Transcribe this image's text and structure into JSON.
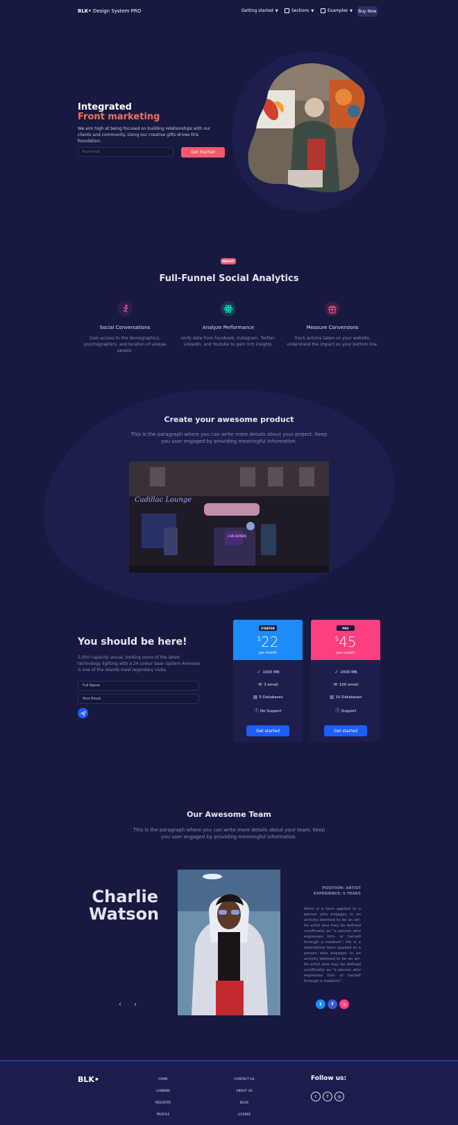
{
  "nav": {
    "brand_bold": "BLK•",
    "brand_rest": " Design System PRO",
    "items": [
      {
        "label": "Getting started",
        "icon": "none"
      },
      {
        "label": "Sections",
        "icon": "sections-icon"
      },
      {
        "label": "Examples",
        "icon": "examples-icon"
      }
    ],
    "buy_label": "Buy Now"
  },
  "hero": {
    "title_line1": "Integrated",
    "title_line2": "Front marketing",
    "text": "We aim high at being focused on building relationships with our clients and community. Using our creative gifts drives this foundation.",
    "email_placeholder": "Your email",
    "cta_label": "Get Started"
  },
  "analytics": {
    "badge": "INSIGHT",
    "title": "Full-Funnel Social Analytics",
    "features": [
      {
        "icon": "running-person-icon",
        "title": "Social Conversations",
        "text": "Gain access to the demographics, psychographics, and location of unique people.",
        "color": "#e14eca"
      },
      {
        "icon": "atom-icon",
        "title": "Analyze Performance",
        "text": "Unify data from Facebook, Instagram, Twitter, LinkedIn, and Youtube to gain rich insights.",
        "color": "#00f2c3"
      },
      {
        "icon": "gift-icon",
        "title": "Measure Conversions",
        "text": "Track actions taken on your website, understand the impact on your bottom line.",
        "color": "#fd5d93"
      }
    ]
  },
  "product": {
    "title": "Create your awesome product",
    "text": "This is the paragraph where you can write more details about your project. Keep you user engaged by providing meaningful information.",
    "sign_text": "Cadillac Lounge",
    "sign_live": "LIVE BANDS"
  },
  "pricing": {
    "title": "You should be here!",
    "text": "5,000 capacity venue, holding some of the latest technology lighting with a 24 colour laser system Amnesia is one of the islands most legendary clubs.",
    "name_placeholder": "Full Name",
    "email_placeholder": "Your Email",
    "cards": [
      {
        "badge": "STARTER",
        "currency": "$",
        "price": "22",
        "period": "per month",
        "color": "#1d8cf8",
        "features": [
          {
            "icon": "check-icon",
            "glyph": "✓",
            "text": "1000 MB"
          },
          {
            "icon": "email-icon",
            "glyph": "✉",
            "text": "3 email"
          },
          {
            "icon": "database-icon",
            "glyph": "▥",
            "text": "5 Databases"
          },
          {
            "icon": "info-icon",
            "glyph": "ⓘ",
            "text": "No Support"
          }
        ],
        "button": "Get started"
      },
      {
        "badge": "PRO",
        "currency": "$",
        "price": "45",
        "period": "per month",
        "color": "#fd3f7f",
        "features": [
          {
            "icon": "check-icon",
            "glyph": "✓",
            "text": "2000 MB"
          },
          {
            "icon": "email-icon",
            "glyph": "✉",
            "text": "100 email"
          },
          {
            "icon": "database-icon",
            "glyph": "▥",
            "text": "10 Databases"
          },
          {
            "icon": "info-icon",
            "glyph": "ⓘ",
            "text": "Support"
          }
        ],
        "button": "Get started"
      }
    ]
  },
  "team": {
    "title": "Our Awesome Team",
    "text": "This is the paragraph where you can write more details about your team. Keep you user engaged by providing meaningful information.",
    "name_line1": "Charlie",
    "name_line2": "Watson",
    "position": "POSITION: ARTIST",
    "experience": "EXPERIENCE: 5 YEARS",
    "bio": "Artist is a term applied to a person who engages in an activity deemed to be an art. An artist also may be defined unofficially as \"a person who expresses him- or herself through a medium\". He is a descriptive term applied to a person who engages in an activity deemed to be an art. An artist also may be defined unofficially as \"a person who expresses him- or herself through a medium\".",
    "prev": "‹",
    "next": "›",
    "social": [
      {
        "icon": "twitter-icon",
        "glyph": "t",
        "color": "#1d8cf8"
      },
      {
        "icon": "facebook-icon",
        "glyph": "f",
        "color": "#3b5bd6"
      },
      {
        "icon": "dribbble-icon",
        "glyph": "◎",
        "color": "#fd3f7f"
      }
    ]
  },
  "footer": {
    "logo": "BLK•",
    "col1": [
      "HOME",
      "LANDING",
      "REGISTER",
      "PROFILE"
    ],
    "col2": [
      "CONTACT US",
      "ABOUT US",
      "BLOG",
      "LICENSE"
    ],
    "follow": "Follow us:",
    "social": [
      {
        "icon": "twitter-icon",
        "glyph": "t"
      },
      {
        "icon": "facebook-icon",
        "glyph": "f"
      },
      {
        "icon": "dribbble-icon",
        "glyph": "◎"
      }
    ]
  }
}
